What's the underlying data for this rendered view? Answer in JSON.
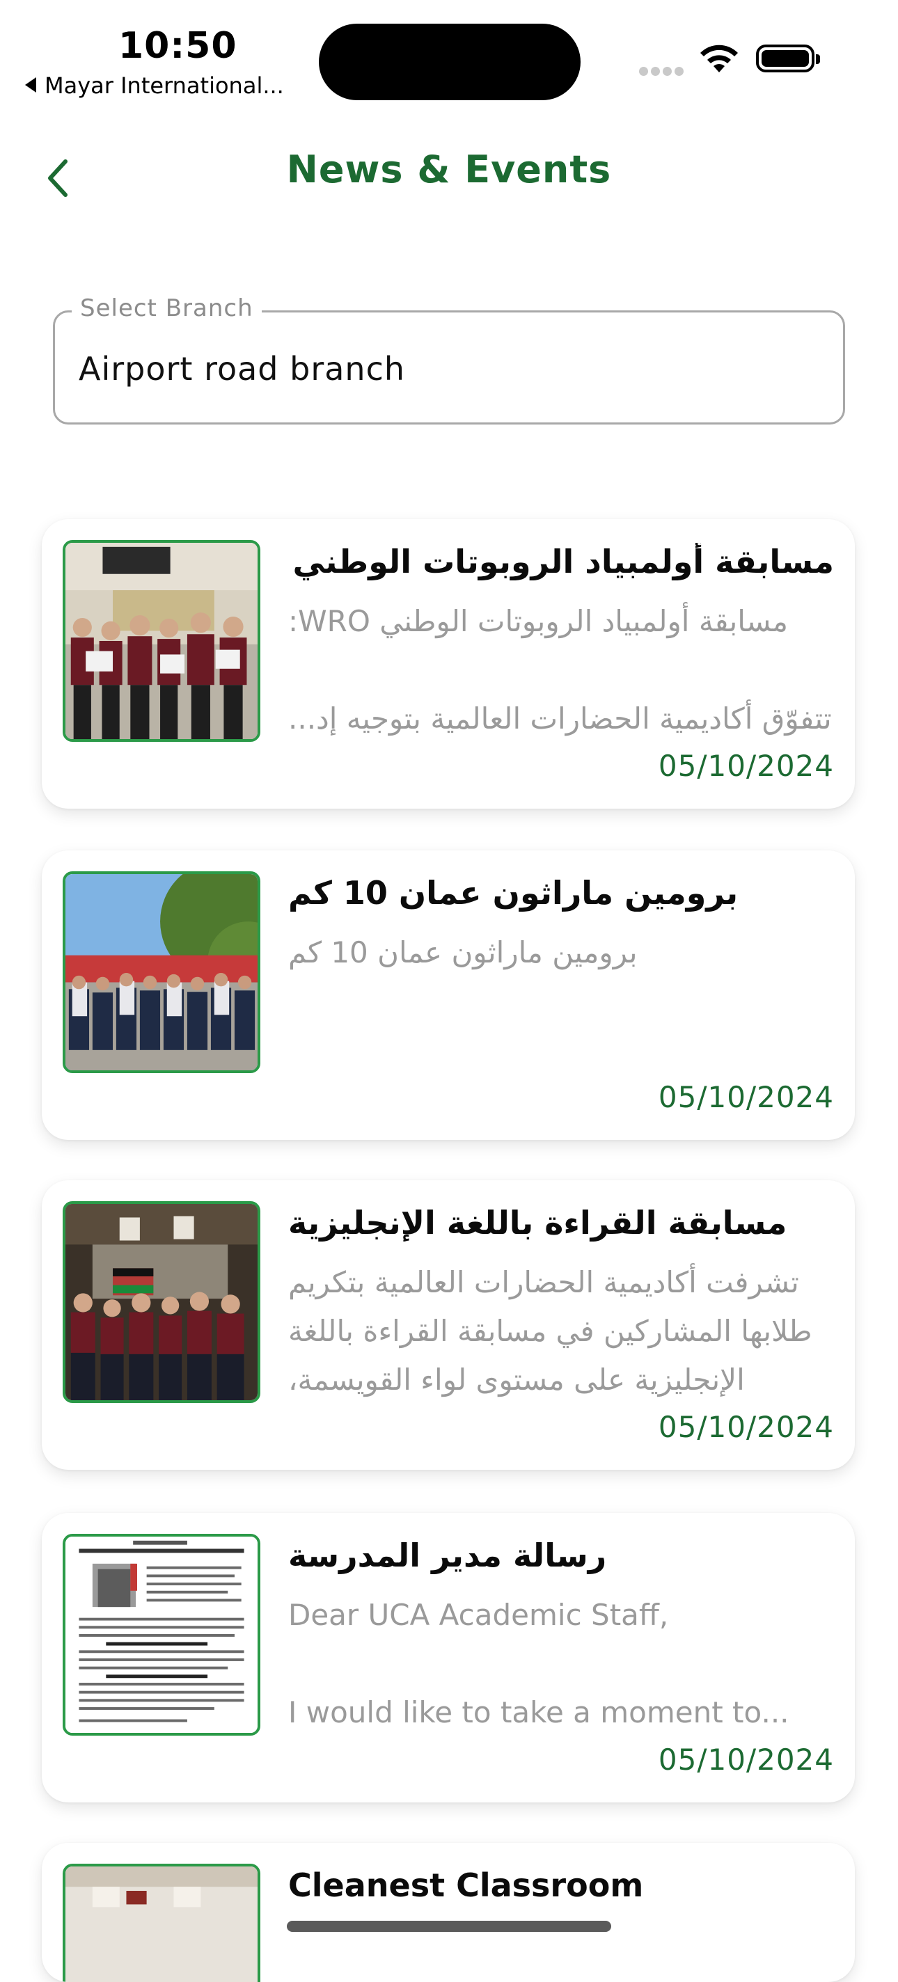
{
  "status_bar": {
    "time": "10:50",
    "back_app": "Mayar International...",
    "icons": [
      "signal-icon",
      "wifi-icon",
      "battery-icon"
    ]
  },
  "header": {
    "title": "News & Events",
    "back_icon": "chevron-left-icon"
  },
  "branch_select": {
    "label": "Select Branch",
    "value": "Airport road branch"
  },
  "news": [
    {
      "title": "مسابقة أولمبياد الروبوتات الوطني WRO",
      "description": "مسابقة أولمبياد الروبوتات الوطني WRO:\n\nتتفوّق أكاديمية الحضارات العالمية بتوجيه إد...",
      "date": "05/10/2024"
    },
    {
      "title": "برومين ماراثون عمان 10 كم",
      "description": "برومين ماراثون عمان 10 كم",
      "date": "05/10/2024"
    },
    {
      "title": "مسابقة القراءة باللغة الإنجليزية",
      "description": "تشرفت أكاديمية الحضارات العالمية بتكريم\nطلابها المشاركين في مسابقة القراءة باللغة\nالإنجليزية على مستوى لواء القويسمة، حيث...",
      "date": "05/10/2024"
    },
    {
      "title": "رسالة مدير المدرسة",
      "description": "Dear UCA Academic Staff,\n\nI would like to take a moment to...",
      "date": "05/10/2024"
    },
    {
      "title": "Cleanest Classroom",
      "description": "",
      "date": ""
    }
  ],
  "colors": {
    "brand_green": "#1c6a32",
    "thumb_border": "#2b9a48"
  }
}
